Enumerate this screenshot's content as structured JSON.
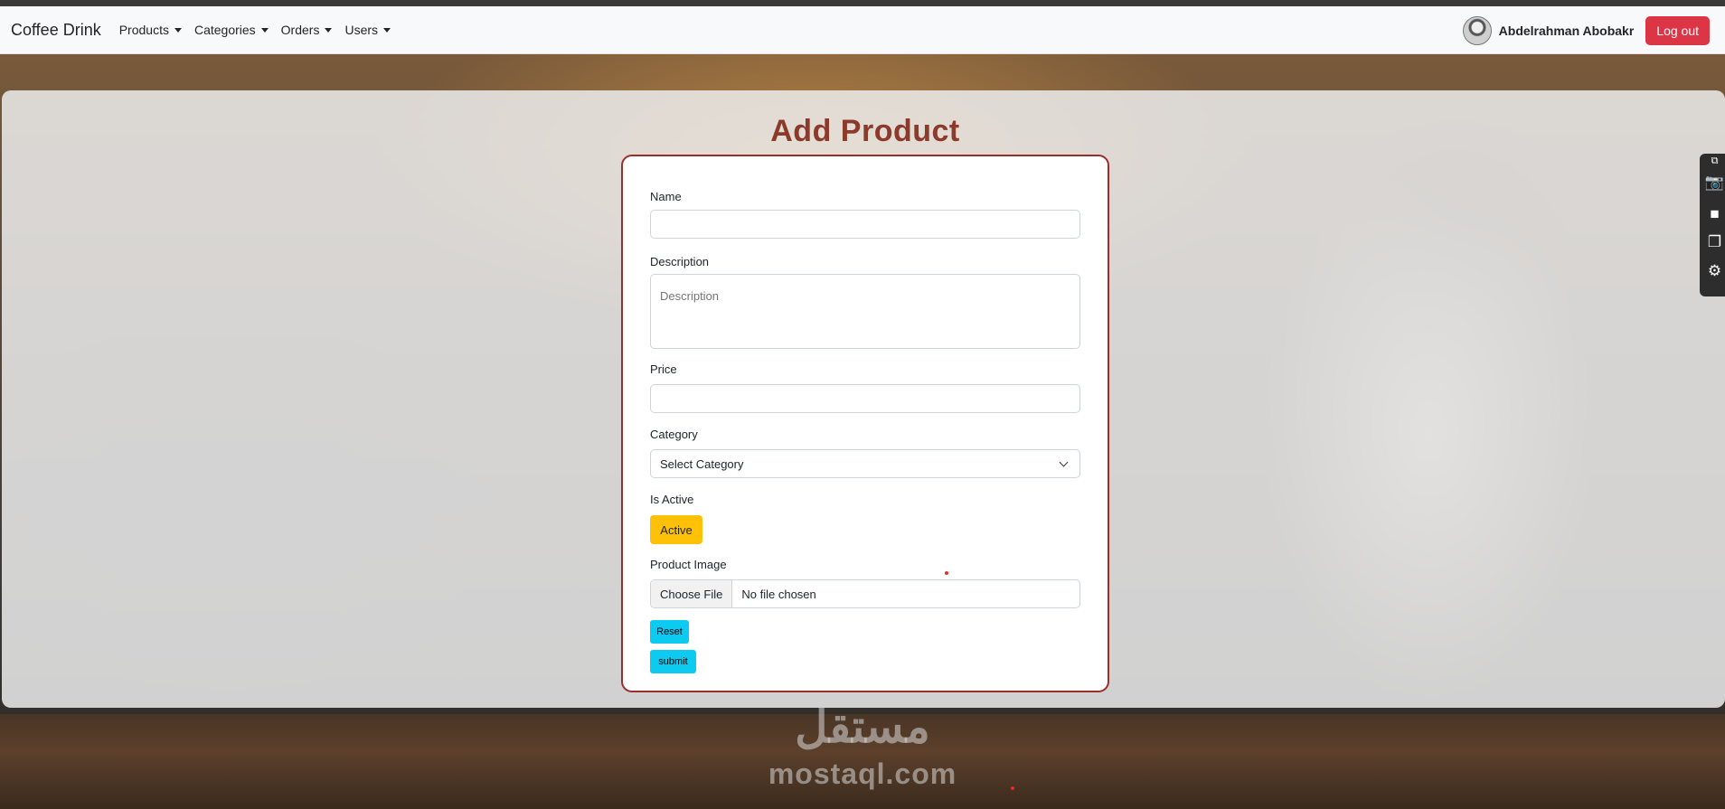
{
  "navbar": {
    "brand": "Coffee Drink",
    "menus": [
      {
        "label": "Products"
      },
      {
        "label": "Categories"
      },
      {
        "label": "Orders"
      },
      {
        "label": "Users"
      }
    ],
    "username": "Abdelrahman Abobakr",
    "logout_label": "Log out"
  },
  "page": {
    "title": "Add Product"
  },
  "form": {
    "name_label": "Name",
    "name_value": "",
    "description_label": "Description",
    "description_placeholder": "Description",
    "price_label": "Price",
    "price_value": "",
    "category_label": "Category",
    "category_selected": "Select Category",
    "is_active_label": "Is Active",
    "active_button": "Active",
    "image_label": "Product Image",
    "choose_file_label": "Choose File",
    "file_status": "No file chosen",
    "reset_label": "Reset",
    "submit_label": "submit"
  },
  "toolbar": {
    "icons": [
      "screenshot-icon",
      "camera-icon",
      "video-icon",
      "windows-icon",
      "gear-icon"
    ]
  },
  "watermark": {
    "arabic": "مستقل",
    "latin": "mostaql.com"
  },
  "colors": {
    "accent": "#8b3a2b",
    "logout": "#dc3545",
    "active": "#ffc107",
    "info": "#0dcaf0"
  }
}
